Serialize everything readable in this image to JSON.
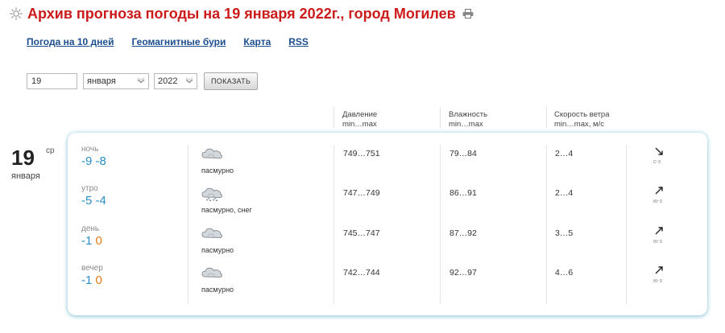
{
  "title": "Архив прогноза погоды на 19 января 2022г., город Могилев",
  "nav": [
    "Погода на 10 дней",
    "Геомагнитные бури",
    "Карта",
    "RSS"
  ],
  "form": {
    "day": "19",
    "month": "января",
    "year": "2022",
    "button": "ПОКАЗАТЬ"
  },
  "headers": {
    "pressure": [
      "Давление",
      "min…max"
    ],
    "humidity": [
      "Влажность",
      "min…max"
    ],
    "wind": [
      "Скорость ветра",
      "min…max, м/с"
    ]
  },
  "date": {
    "day": "19",
    "weekday": "ср",
    "month": "января"
  },
  "rows": [
    {
      "period": "ночь",
      "t1": "-9",
      "t2": "-8",
      "t2_warm": false,
      "condition": "пасмурно",
      "icon": "cloud-icon",
      "pressure": "749…751",
      "humidity": "79…84",
      "wind": "2…4",
      "wind_dir": "с-з",
      "wind_arrow": "arrow-down-right-icon"
    },
    {
      "period": "утро",
      "t1": "-5",
      "t2": "-4",
      "t2_warm": false,
      "condition": "пасмурно, снег",
      "icon": "cloud-snow-icon",
      "pressure": "747…749",
      "humidity": "86…91",
      "wind": "2…4",
      "wind_dir": "ю-з",
      "wind_arrow": "arrow-up-right-icon"
    },
    {
      "period": "день",
      "t1": "-1",
      "t2": "0",
      "t2_warm": true,
      "condition": "пасмурно",
      "icon": "cloud-icon",
      "pressure": "745…747",
      "humidity": "87…92",
      "wind": "3…5",
      "wind_dir": "ю-з",
      "wind_arrow": "arrow-up-right-icon"
    },
    {
      "period": "вечер",
      "t1": "-1",
      "t2": "0",
      "t2_warm": true,
      "condition": "пасмурно",
      "icon": "cloud-icon",
      "pressure": "742…744",
      "humidity": "92…97",
      "wind": "4…6",
      "wind_dir": "ю-з",
      "wind_arrow": "arrow-up-right-icon"
    }
  ],
  "colors": {
    "title": "#cc1b1b",
    "link": "#1c4d8e",
    "cold": "#2a8ec7",
    "warm": "#e07a17"
  }
}
